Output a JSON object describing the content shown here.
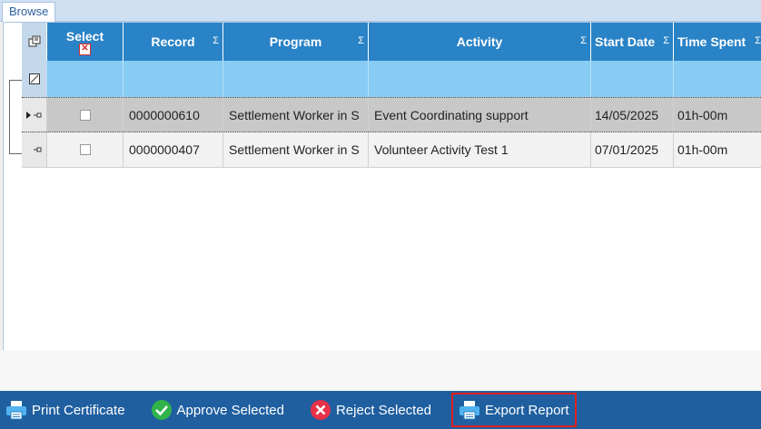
{
  "tab": {
    "label": "Browse"
  },
  "grid": {
    "columns": [
      {
        "label": "Select",
        "sigma": ""
      },
      {
        "label": "Record",
        "sigma": "Σ"
      },
      {
        "label": "Program",
        "sigma": "Σ"
      },
      {
        "label": "Activity",
        "sigma": "Σ"
      },
      {
        "label": "Start Date",
        "sigma": "Σ"
      },
      {
        "label": "Time Spent",
        "sigma": "Σ"
      }
    ],
    "rows": [
      {
        "record": "0000000610",
        "program": "Settlement Worker in S",
        "activity": "Event Coordinating support",
        "start_date": "14/05/2025",
        "time_spent": "01h-00m",
        "selected": false
      },
      {
        "record": "0000000407",
        "program": "Settlement Worker in S",
        "activity": "Volunteer Activity Test 1",
        "start_date": "07/01/2025",
        "time_spent": "01h-00m",
        "selected": false
      }
    ]
  },
  "toolbar": {
    "print_certificate": "Print Certificate",
    "approve_selected": "Approve Selected",
    "reject_selected": "Reject Selected",
    "export_report": "Export Report"
  },
  "icons": {
    "print": "printer-icon",
    "approve": "check-circle-icon",
    "reject": "x-circle-icon",
    "export": "printer-icon"
  },
  "colors": {
    "header": "#2a83c6",
    "filter_row": "#88cbf5",
    "toolbar": "#1f5fa0",
    "highlight": "#e02020",
    "approve": "#2fb34a",
    "reject": "#e8324a"
  }
}
